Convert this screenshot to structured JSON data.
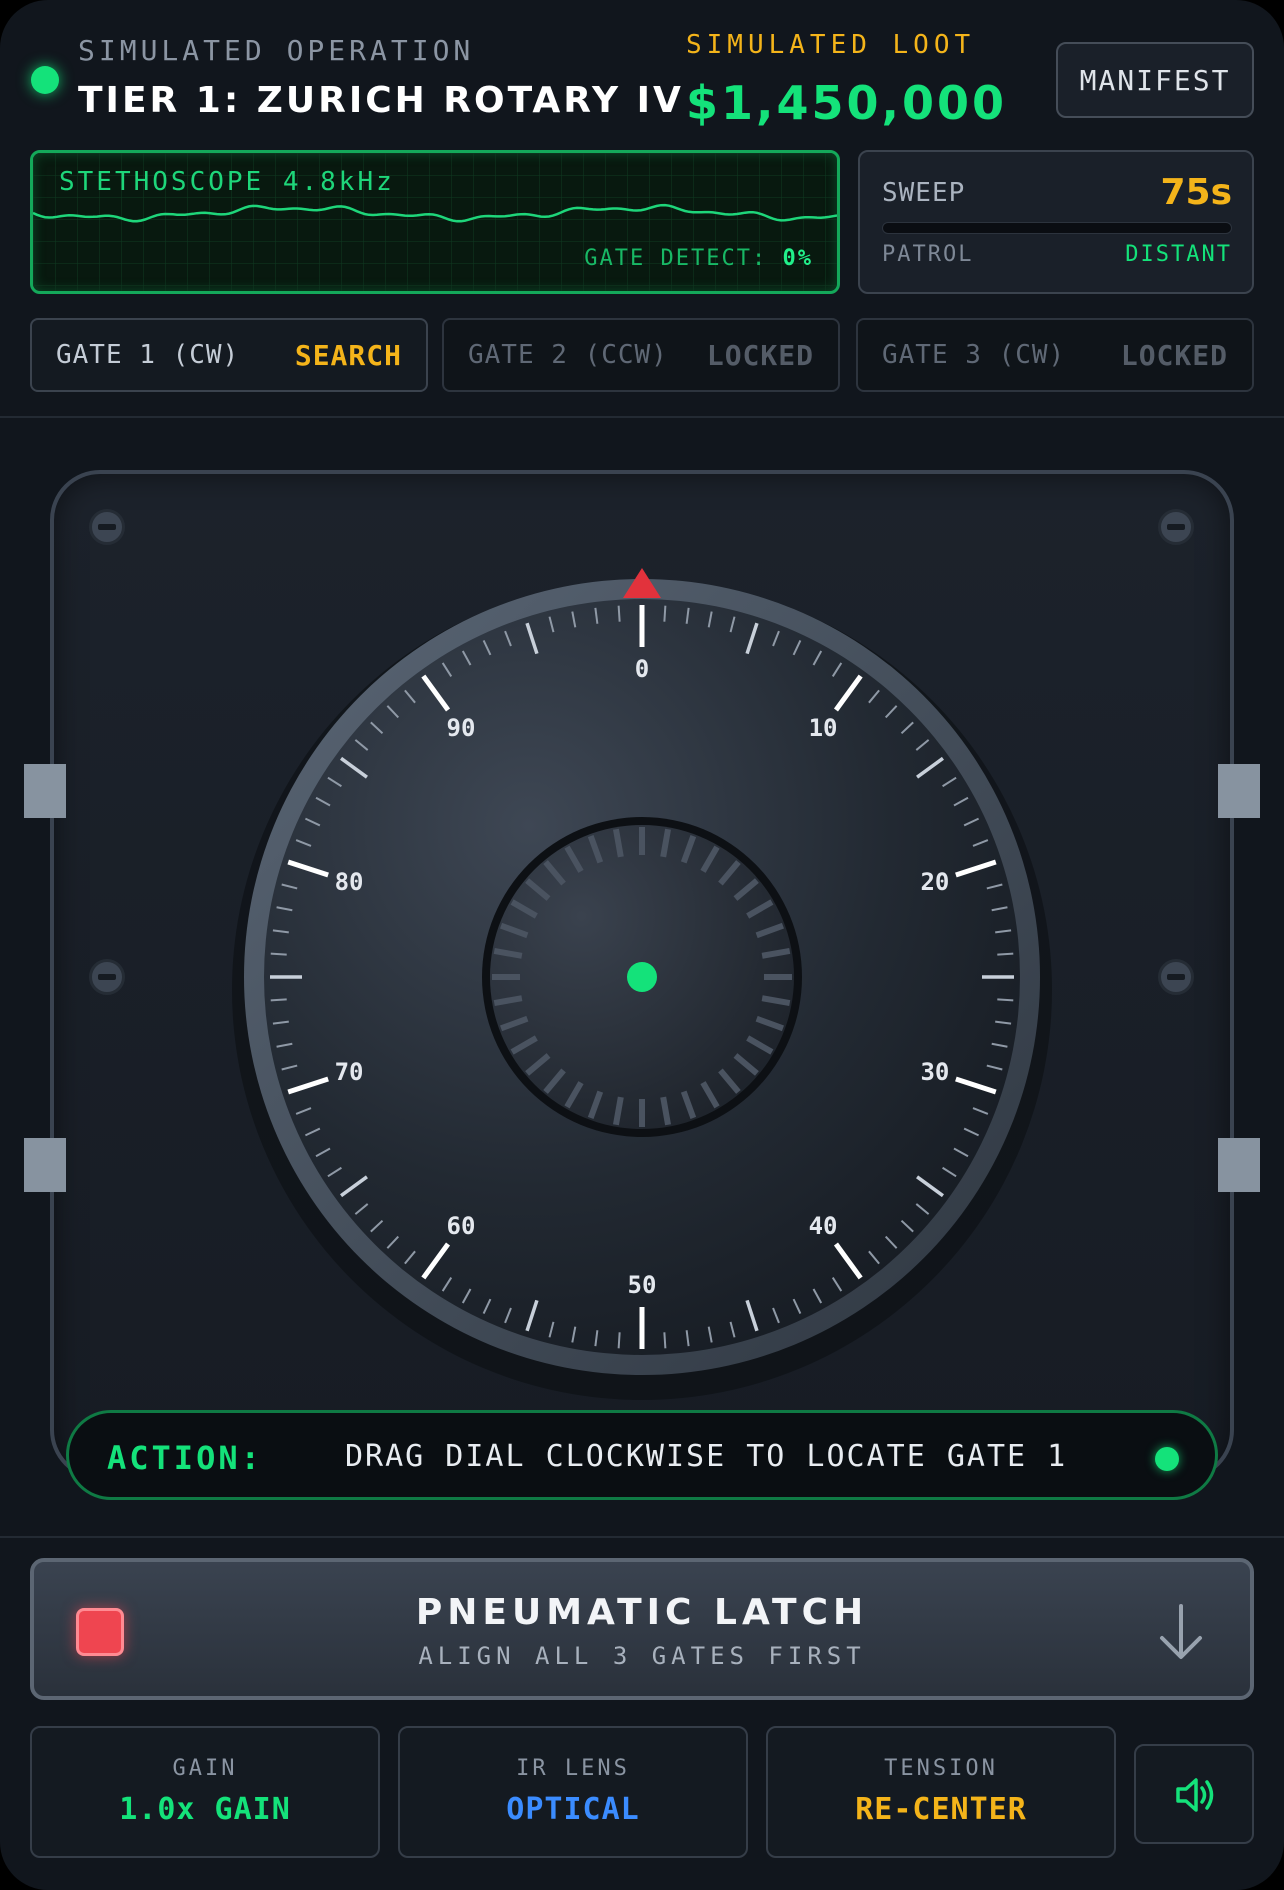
{
  "header": {
    "operation_label": "SIMULATED OPERATION",
    "operation_title": "TIER 1: ZURICH ROTARY IV",
    "loot_label": "SIMULATED LOOT",
    "loot_value": "$1,450,000",
    "manifest_label": "MANIFEST"
  },
  "stethoscope": {
    "label": "STETHOSCOPE 4.8kHz",
    "gate_detect_label": "GATE DETECT:",
    "gate_detect_value": "0%"
  },
  "sweep": {
    "label": "SWEEP",
    "value": "75s",
    "progress": 0,
    "patrol_label": "PATROL",
    "patrol_value": "DISTANT"
  },
  "gates": [
    {
      "name": "GATE 1 (CW)",
      "state": "SEARCH"
    },
    {
      "name": "GATE 2 (CCW)",
      "state": "LOCKED"
    },
    {
      "name": "GATE 3 (CW)",
      "state": "LOCKED"
    }
  ],
  "dial": {
    "labels": [
      "0",
      "10",
      "20",
      "30",
      "40",
      "50",
      "60",
      "70",
      "80",
      "90"
    ],
    "pointer_color": "#e2323c",
    "center_color": "#14e27a"
  },
  "action": {
    "label": "ACTION:",
    "text": "DRAG DIAL CLOCKWISE TO LOCATE GATE 1"
  },
  "latch": {
    "title": "PNEUMATIC LATCH",
    "subtitle": "ALIGN ALL 3 GATES FIRST",
    "icon": "arrow-down-icon"
  },
  "controls": [
    {
      "label": "GAIN",
      "value": "1.0x GAIN",
      "color": "#14e27a"
    },
    {
      "label": "IR LENS",
      "value": "OPTICAL",
      "color": "#3b8cff"
    },
    {
      "label": "TENSION",
      "value": "RE-CENTER",
      "color": "#f4b41a"
    }
  ],
  "sound": {
    "icon": "speaker-icon"
  }
}
